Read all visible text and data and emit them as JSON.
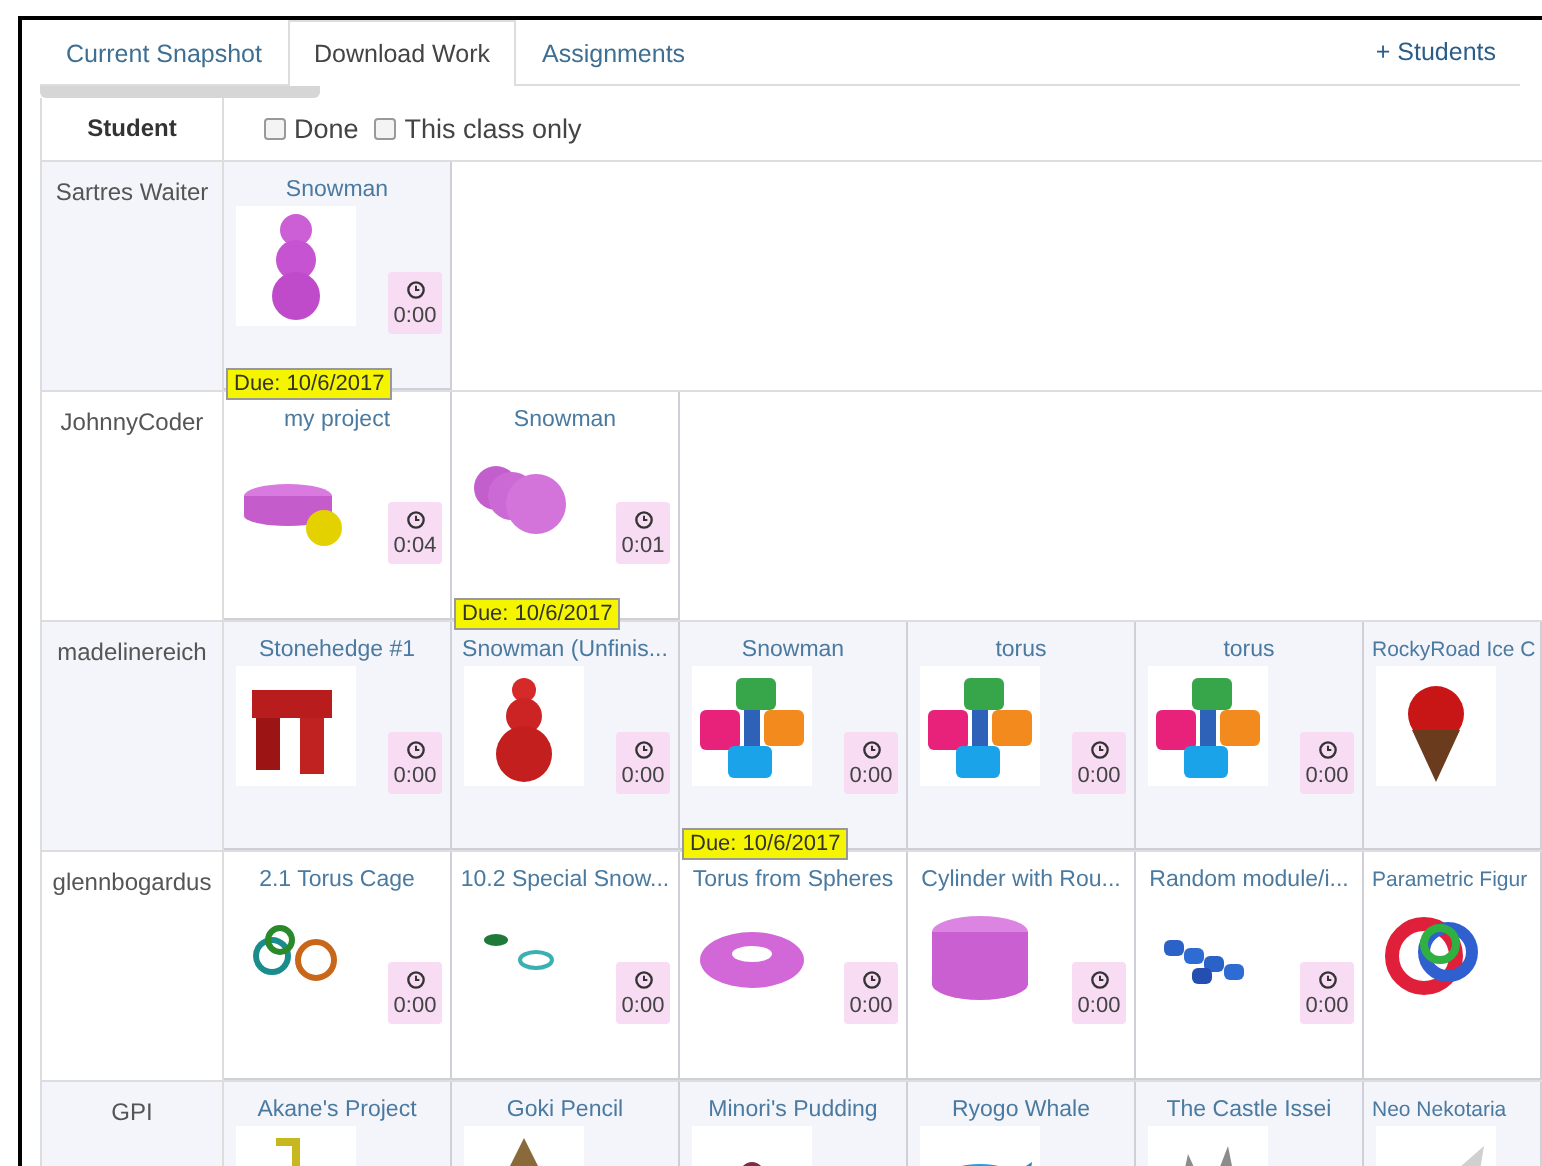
{
  "tabs": [
    {
      "label": "Current Snapshot",
      "selected": false
    },
    {
      "label": "Download Work",
      "selected": true
    },
    {
      "label": "Assignments",
      "selected": false
    }
  ],
  "add_students": "+ Students",
  "table": {
    "student_header": "Student",
    "filters": [
      {
        "label": "Done",
        "checked": false
      },
      {
        "label": "This class only",
        "checked": false
      }
    ],
    "rows": [
      {
        "student": "Sartres Waiter",
        "works": [
          {
            "title": "Snowman",
            "time": "0:00",
            "due": "Due: 10/6/2017"
          }
        ]
      },
      {
        "student": "JohnnyCoder",
        "works": [
          {
            "title": "my project",
            "time": "0:04"
          },
          {
            "title": "Snowman",
            "time": "0:01",
            "due": "Due: 10/6/2017"
          }
        ]
      },
      {
        "student": "madelinereich",
        "works": [
          {
            "title": "Stonehedge #1",
            "time": "0:00"
          },
          {
            "title": "Snowman (Unfinis...",
            "time": "0:00"
          },
          {
            "title": "Snowman",
            "time": "0:00",
            "due": "Due: 10/6/2017"
          },
          {
            "title": "torus",
            "time": "0:00"
          },
          {
            "title": "torus",
            "time": "0:00"
          },
          {
            "title": "RockyRoad Ice C"
          }
        ]
      },
      {
        "student": "glennbogardus",
        "works": [
          {
            "title": "2.1 Torus Cage",
            "time": "0:00"
          },
          {
            "title": "10.2 Special Snow...",
            "time": "0:00"
          },
          {
            "title": "Torus from Spheres",
            "time": "0:00"
          },
          {
            "title": "Cylinder with Rou...",
            "time": "0:00"
          },
          {
            "title": "Random module/i...",
            "time": "0:00"
          },
          {
            "title": "Parametric Figur"
          }
        ]
      },
      {
        "student": "GPI",
        "works": [
          {
            "title": "Akane's Project"
          },
          {
            "title": "Goki Pencil"
          },
          {
            "title": "Minori's Pudding"
          },
          {
            "title": "Ryogo Whale"
          },
          {
            "title": "The Castle Issei"
          },
          {
            "title": "Neo Nekotaria"
          }
        ]
      }
    ]
  }
}
